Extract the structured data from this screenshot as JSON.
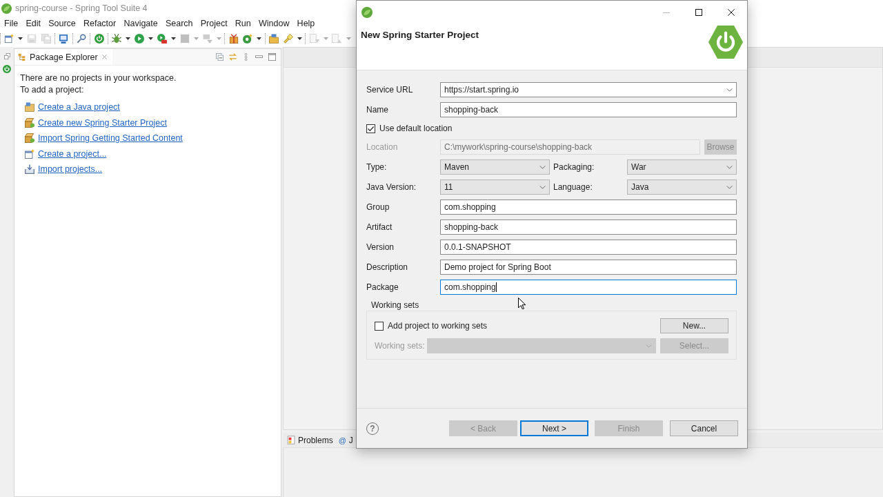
{
  "window": {
    "title": "spring-course - Spring Tool Suite 4"
  },
  "menu": [
    "File",
    "Edit",
    "Source",
    "Refactor",
    "Navigate",
    "Search",
    "Project",
    "Run",
    "Window",
    "Help"
  ],
  "toolbar": [
    [
      {
        "kind": "newfile",
        "dropdown": true,
        "disabled": false
      },
      {
        "kind": "save",
        "dropdown": false,
        "disabled": true
      },
      {
        "kind": "saveall",
        "dropdown": false,
        "disabled": true
      }
    ],
    [
      {
        "kind": "console",
        "dropdown": false,
        "disabled": false
      }
    ],
    [
      {
        "kind": "tool",
        "dropdown": false,
        "disabled": false
      }
    ],
    [
      {
        "kind": "boot",
        "dropdown": false,
        "disabled": false
      }
    ],
    [
      {
        "kind": "debug",
        "dropdown": true,
        "disabled": false
      },
      {
        "kind": "run",
        "dropdown": true,
        "disabled": false
      },
      {
        "kind": "external",
        "dropdown": true,
        "disabled": false
      },
      {
        "kind": "stop",
        "dropdown": true,
        "disabled": true
      },
      {
        "kind": "deploy",
        "dropdown": true,
        "disabled": true
      }
    ],
    [
      {
        "kind": "gift",
        "dropdown": false,
        "disabled": false
      },
      {
        "kind": "newclass",
        "dropdown": true,
        "disabled": false
      }
    ],
    [
      {
        "kind": "open",
        "dropdown": false,
        "disabled": false
      },
      {
        "kind": "flashlight",
        "dropdown": true,
        "disabled": false
      }
    ],
    [
      {
        "kind": "nextedit",
        "dropdown": true,
        "disabled": true
      },
      {
        "kind": "prevedit",
        "dropdown": true,
        "disabled": true
      }
    ]
  ],
  "explorer": {
    "tab": "Package Explorer",
    "message": [
      "There are no projects in your workspace.",
      "To add a project:"
    ],
    "links": [
      {
        "kind": "javaproject",
        "label": "Create a Java project"
      },
      {
        "kind": "springstarter",
        "label": "Create new Spring Starter Project"
      },
      {
        "kind": "springimport",
        "label": "Import Spring Getting Started Content"
      },
      {
        "kind": "project",
        "label": "Create a project..."
      },
      {
        "kind": "import",
        "label": "Import projects..."
      }
    ]
  },
  "bottom_panel": {
    "tabs": [
      {
        "kind": "problems",
        "label": "Problems"
      },
      {
        "kind": "javadoc",
        "glyph": "@",
        "label": "J"
      }
    ]
  },
  "dialog": {
    "window_buttons": [
      {
        "kind": "minimize",
        "disabled": true
      },
      {
        "kind": "maximize",
        "disabled": false
      },
      {
        "kind": "close",
        "disabled": false
      }
    ],
    "title": "New Spring Starter Project",
    "fields": [
      {
        "kind": "combo",
        "label": "Service URL",
        "value": "https://start.spring.io"
      },
      {
        "kind": "text",
        "label": "Name",
        "value": "shopping-back",
        "focused": false
      },
      {
        "kind": "checkbox",
        "label": "Use default location",
        "checked": true
      },
      {
        "kind": "browse",
        "label": "Location",
        "value": "C:\\mywork\\spring-course\\shopping-back",
        "button": "Browse",
        "disabled": true
      },
      {
        "kind": "pair",
        "items": [
          {
            "label": "Type:",
            "value": "Maven"
          },
          {
            "label": "Packaging:",
            "value": "War"
          }
        ]
      },
      {
        "kind": "pair",
        "items": [
          {
            "label": "Java Version:",
            "value": "11"
          },
          {
            "label": "Language:",
            "value": "Java"
          }
        ]
      },
      {
        "kind": "text",
        "label": "Group",
        "value": "com.shopping",
        "focused": false
      },
      {
        "kind": "text",
        "label": "Artifact",
        "value": "shopping-back",
        "focused": false
      },
      {
        "kind": "text",
        "label": "Version",
        "value": "0.0.1-SNAPSHOT",
        "focused": false
      },
      {
        "kind": "text",
        "label": "Description",
        "value": "Demo project for Spring Boot",
        "focused": false
      },
      {
        "kind": "text",
        "label": "Package",
        "value": "com.shopping",
        "focused": true
      }
    ],
    "working_sets": {
      "title": "Working sets",
      "add": {
        "label": "Add project to working sets",
        "checked": false
      },
      "new_button": {
        "label": "New...",
        "disabled": false
      },
      "sets": {
        "label": "Working sets:",
        "disabled": true
      },
      "select_button": {
        "label": "Select...",
        "disabled": true
      }
    },
    "help": "?",
    "buttons": [
      {
        "label": "< Back",
        "disabled": true,
        "default": false
      },
      {
        "label": "Next >",
        "disabled": false,
        "default": true
      },
      {
        "label": "Finish",
        "disabled": true,
        "default": false
      },
      {
        "label": "Cancel",
        "disabled": false,
        "default": false
      }
    ]
  }
}
